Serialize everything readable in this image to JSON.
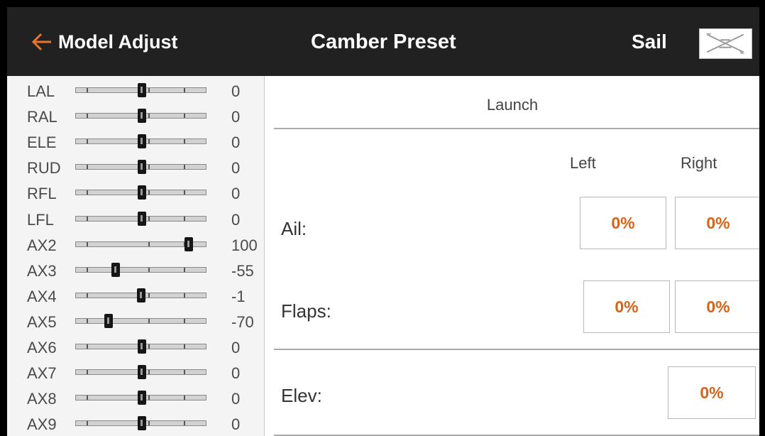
{
  "header": {
    "back_label": "Model Adjust",
    "title": "Camber Preset",
    "model_name": "Sail"
  },
  "colors": {
    "header_bg": "#212121",
    "accent": "#e8752a",
    "value_text": "#d3641c"
  },
  "channels": [
    {
      "name": "LAL",
      "value": "0",
      "position": 0
    },
    {
      "name": "RAL",
      "value": "0",
      "position": 0
    },
    {
      "name": "ELE",
      "value": "0",
      "position": 0
    },
    {
      "name": "RUD",
      "value": "0",
      "position": 0
    },
    {
      "name": "RFL",
      "value": "0",
      "position": 0
    },
    {
      "name": "LFL",
      "value": "0",
      "position": 0
    },
    {
      "name": "AX2",
      "value": "100",
      "position": 100
    },
    {
      "name": "AX3",
      "value": "-55",
      "position": -55
    },
    {
      "name": "AX4",
      "value": "-1",
      "position": -1
    },
    {
      "name": "AX5",
      "value": "-70",
      "position": -70
    },
    {
      "name": "AX6",
      "value": "0",
      "position": 0
    },
    {
      "name": "AX7",
      "value": "0",
      "position": 0
    },
    {
      "name": "AX8",
      "value": "0",
      "position": 0
    },
    {
      "name": "AX9",
      "value": "0",
      "position": 0
    }
  ],
  "panel": {
    "section_title": "Launch",
    "col_left": "Left",
    "col_right": "Right",
    "rows": {
      "ail": {
        "label": "Ail:",
        "left": "0%",
        "right": "0%"
      },
      "flaps": {
        "label": "Flaps:",
        "left": "0%",
        "right": "0%"
      },
      "elev": {
        "label": "Elev:",
        "value": "0%"
      }
    }
  }
}
